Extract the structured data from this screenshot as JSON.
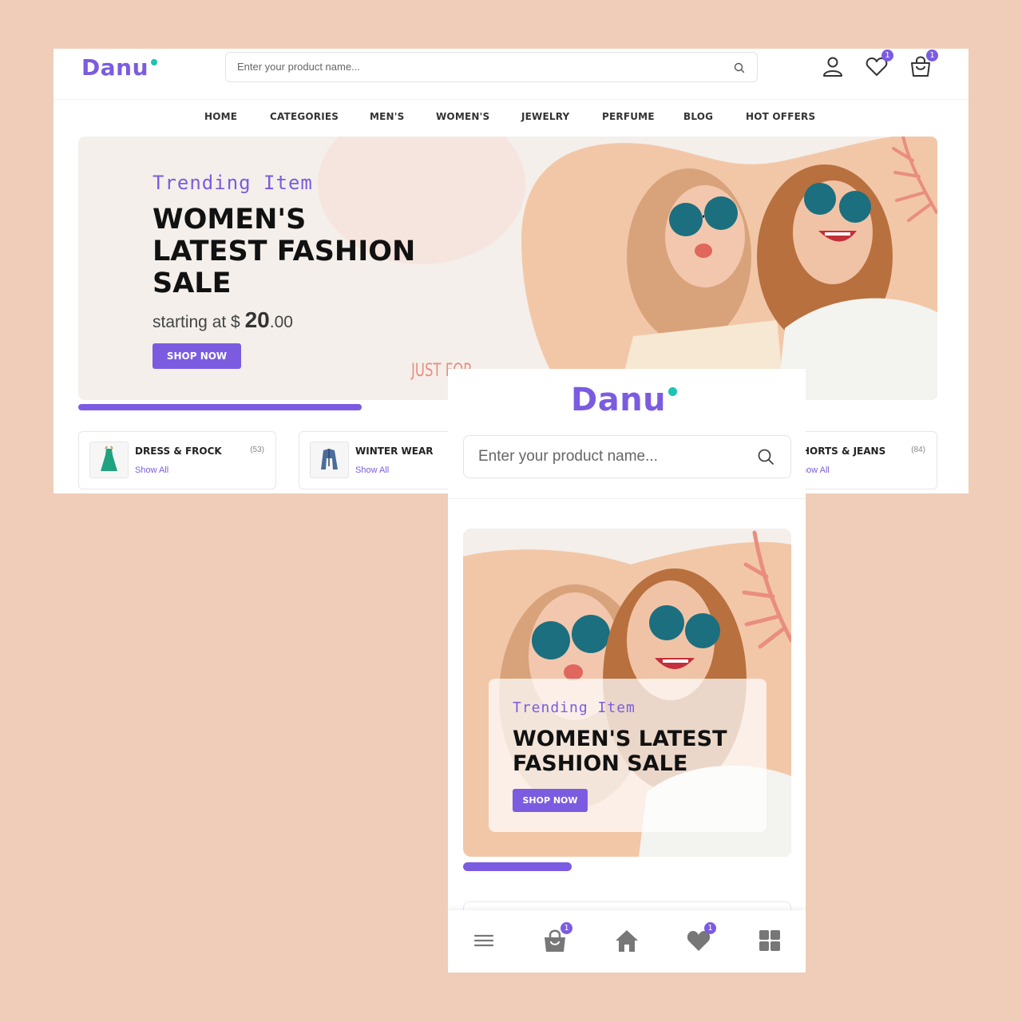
{
  "colors": {
    "background": "#f0cdb8",
    "accent": "#7b5ce0",
    "logo_dot": "#1fc2b3",
    "hero_bg": "#f4efea",
    "leaf": "#e98e7f"
  },
  "desktop": {
    "logo": "Danu",
    "search": {
      "placeholder": "Enter your product name...",
      "icon": "search-icon"
    },
    "header_icons": [
      {
        "name": "user-icon"
      },
      {
        "name": "heart-icon",
        "badge": "1"
      },
      {
        "name": "bag-icon",
        "badge": "1"
      }
    ],
    "nav": [
      "HOME",
      "CATEGORIES",
      "MEN'S",
      "WOMEN'S",
      "JEWELRY",
      "PERFUME",
      "BLOG",
      "HOT OFFERS"
    ],
    "hero": {
      "subtitle": "Trending Item",
      "title": "WOMEN'S LATEST FASHION SALE",
      "price_prefix": "starting at $",
      "price_whole": "20",
      "price_cents": ".00",
      "button": "SHOP NOW",
      "corner_text": "JUST FOR"
    },
    "slider_progress": 0.33,
    "categories": [
      {
        "name": "DRESS & FROCK",
        "count": "(53)",
        "link": "Show All",
        "icon": "dress-icon"
      },
      {
        "name": "WINTER WEAR",
        "count": "",
        "link": "Show All",
        "icon": "jacket-icon"
      },
      {
        "name": "HORTS & JEANS",
        "count": "(84)",
        "link": "now All",
        "icon": ""
      }
    ]
  },
  "mobile": {
    "logo": "Danu",
    "search": {
      "placeholder": "Enter your product name...",
      "icon": "search-icon"
    },
    "hero": {
      "subtitle": "Trending Item",
      "title": "WOMEN'S LATEST FASHION SALE",
      "button": "SHOP NOW"
    },
    "slider_progress": 0.33,
    "bottom_nav": [
      {
        "name": "menu-icon"
      },
      {
        "name": "bag-icon",
        "badge": "1"
      },
      {
        "name": "home-icon"
      },
      {
        "name": "heart-icon",
        "badge": "1"
      },
      {
        "name": "grid-icon"
      }
    ]
  }
}
